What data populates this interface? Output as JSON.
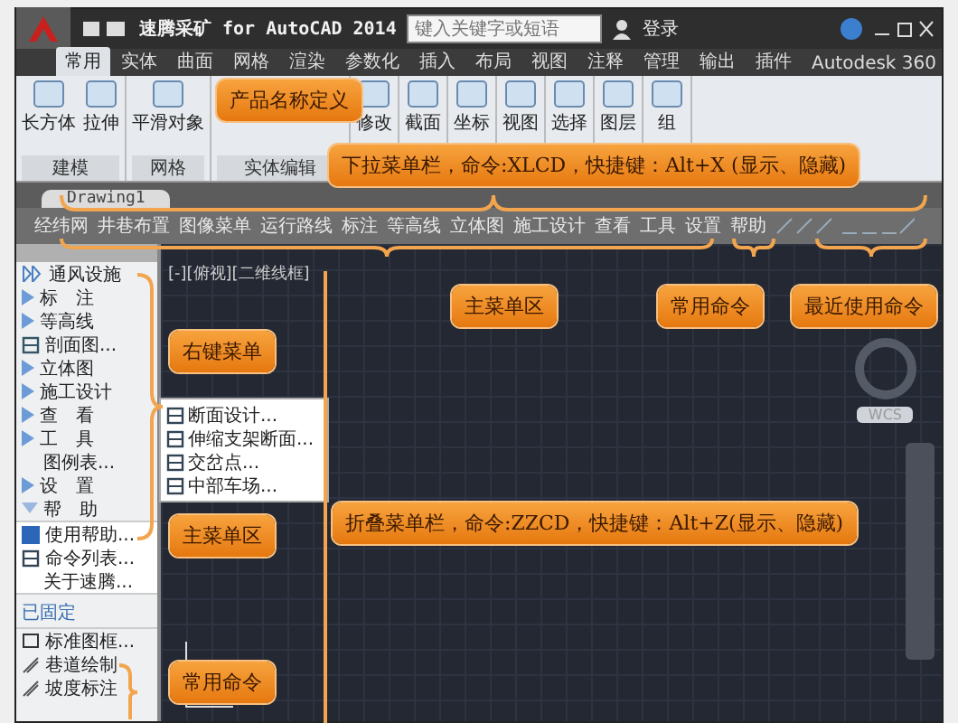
{
  "title_bar": {
    "app_name": "速腾采矿 for AutoCAD 2014",
    "search": {
      "placeholder": "键入关键字或短语"
    },
    "login": "登录"
  },
  "ribbon_tabs": [
    {
      "label": "常用",
      "selected": true
    },
    {
      "label": "实体",
      "selected": false
    },
    {
      "label": "曲面",
      "selected": false
    },
    {
      "label": "网格",
      "selected": false
    },
    {
      "label": "渲染",
      "selected": false
    },
    {
      "label": "参数化",
      "selected": false
    },
    {
      "label": "插入",
      "selected": false
    },
    {
      "label": "布局",
      "selected": false
    },
    {
      "label": "视图",
      "selected": false
    },
    {
      "label": "注释",
      "selected": false
    },
    {
      "label": "管理",
      "selected": false
    },
    {
      "label": "输出",
      "selected": false
    },
    {
      "label": "插件",
      "selected": false
    },
    {
      "label": "Autodesk 360",
      "selected": false
    }
  ],
  "ribbon_panels": [
    {
      "label": "建模",
      "tools": [
        "长方体",
        "拉伸"
      ]
    },
    {
      "label": "网格",
      "tools": [
        "平滑对象"
      ]
    },
    {
      "label": "实体编辑"
    },
    {
      "tools": [
        "修改"
      ]
    },
    {
      "tools": [
        "截面"
      ]
    },
    {
      "tools": [
        "坐标"
      ]
    },
    {
      "tools": [
        "视图"
      ]
    },
    {
      "tools": [
        "选择"
      ]
    },
    {
      "tools": [
        "图层"
      ]
    },
    {
      "tools": [
        "组"
      ]
    }
  ],
  "document_tabs": [
    {
      "label": "Drawing1",
      "selected": true
    }
  ],
  "menu_bar": [
    "经纬网",
    "井巷布置",
    "图像菜单",
    "运行路线",
    "标注",
    "等高线",
    "立体图",
    "施工设计",
    "查看",
    "工具",
    "设置",
    "帮助"
  ],
  "viewport": {
    "label": "[-][俯视][二维线框]",
    "ucs": "WCS"
  },
  "side_menu": [
    {
      "label": "通风设施",
      "kind": "double"
    },
    {
      "label": "标　注",
      "kind": "submenu"
    },
    {
      "label": "等高线",
      "kind": "submenu"
    },
    {
      "label": "剖面图...",
      "kind": "dialog"
    },
    {
      "label": "立体图",
      "kind": "submenu"
    },
    {
      "label": "施工设计",
      "kind": "submenu"
    },
    {
      "label": "查　看",
      "kind": "submenu"
    },
    {
      "label": "工　具",
      "kind": "submenu"
    },
    {
      "label": "图例表...",
      "kind": "plain"
    },
    {
      "label": "设　置",
      "kind": "submenu"
    },
    {
      "label": "帮　助",
      "kind": "submenu",
      "expanded": true,
      "children": [
        {
          "label": "使用帮助...",
          "kind": "help"
        },
        {
          "label": "命令列表...",
          "kind": "list"
        },
        {
          "label": "关于速腾...",
          "kind": "plain"
        }
      ]
    }
  ],
  "pinned": {
    "title": "已固定",
    "items": [
      {
        "label": "标准图框...",
        "kind": "frame"
      },
      {
        "label": "巷道绘制",
        "kind": "line"
      },
      {
        "label": "坡度标注",
        "kind": "line"
      }
    ]
  },
  "context_menu": [
    "断面设计...",
    "伸缩支架断面...",
    "交岔点...",
    "中部车场..."
  ],
  "callouts": [
    {
      "text": "产品名称定义"
    },
    {
      "text": "下拉菜单栏，命令:XLCD，快捷键：Alt+X (显示、隐藏)"
    },
    {
      "text": "主菜单区"
    },
    {
      "text": "常用命令"
    },
    {
      "text": "最近使用命令"
    },
    {
      "text": "右键菜单"
    },
    {
      "text": "主菜单区"
    },
    {
      "text": "折叠菜单栏，命令:ZZCD，快捷键：Alt+Z(显示、隐藏)"
    },
    {
      "text": "常用命令"
    }
  ]
}
